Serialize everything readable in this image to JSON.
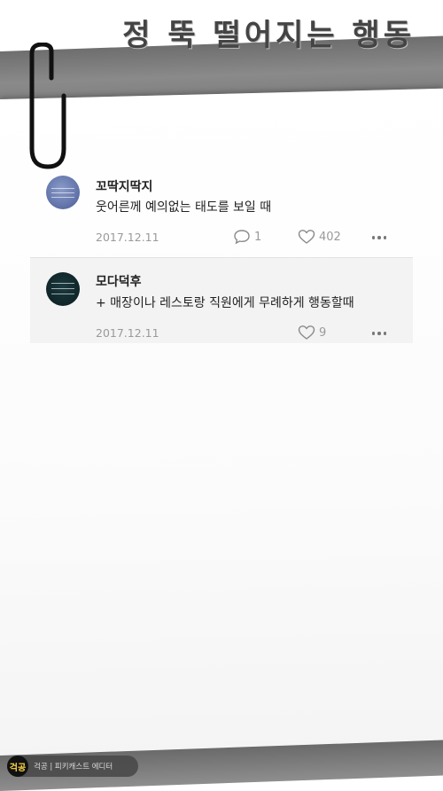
{
  "page": {
    "title": "정 뚝 떨어지는 행동"
  },
  "comments": [
    {
      "author": "꼬딱지딱지",
      "text": "웃어른께 예의없는 태도를 보일 때",
      "date": "2017.12.11",
      "replies": "1",
      "likes": "402"
    },
    {
      "author": "모다덕후",
      "text": "+ 매장이나 레스토랑 직원에게 무례하게 행동할때",
      "date": "2017.12.11",
      "likes": "9"
    }
  ],
  "footer": {
    "logo": "걱공",
    "text": "걱공 | 피키캐스트 에디터"
  },
  "colors": {
    "strip": "#7a7a7a",
    "meta_text": "#9a9a9a",
    "logo_accent": "#ffd84a"
  }
}
